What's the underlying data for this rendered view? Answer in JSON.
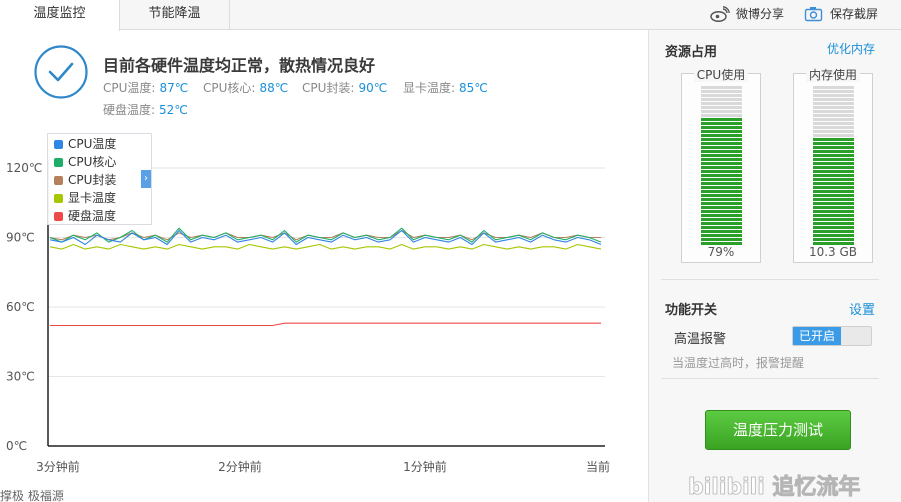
{
  "tabs": [
    {
      "label": "温度监控",
      "active": true
    },
    {
      "label": "节能降温",
      "active": false
    }
  ],
  "top_actions": {
    "share_label": "微博分享",
    "screenshot_label": "保存截屏"
  },
  "summary": {
    "title": "目前各硬件温度均正常，散热情况良好",
    "readings": [
      {
        "label": "CPU温度:",
        "value": "87℃"
      },
      {
        "label": "CPU核心:",
        "value": "88℃"
      },
      {
        "label": "CPU封装:",
        "value": "90℃"
      },
      {
        "label": "显卡温度:",
        "value": "85℃"
      },
      {
        "label": "硬盘温度:",
        "value": "52℃"
      }
    ]
  },
  "chart_data": {
    "type": "line",
    "ylim": [
      0,
      120
    ],
    "y_ticks": [
      "120℃",
      "90℃",
      "60℃",
      "30℃",
      "0℃"
    ],
    "x_ticks": [
      "3分钟前",
      "2分钟前",
      "1分钟前",
      "当前"
    ],
    "grid": true,
    "legend_position": "top-left",
    "series": [
      {
        "name": "CPU温度",
        "color": "#2f86e5",
        "values": [
          89,
          88,
          90,
          87,
          91,
          89,
          88,
          92,
          89,
          90,
          87,
          93,
          88,
          90,
          89,
          91,
          88,
          89,
          90,
          88,
          92,
          87,
          90,
          89,
          88,
          91,
          89,
          90,
          88,
          89,
          93,
          88,
          90,
          89,
          88,
          90,
          87,
          92,
          88,
          89,
          90,
          88,
          91,
          89,
          88,
          90,
          89,
          87
        ]
      },
      {
        "name": "CPU核心",
        "color": "#1fae6a",
        "values": [
          90,
          88,
          91,
          89,
          92,
          88,
          90,
          93,
          89,
          91,
          88,
          94,
          89,
          91,
          90,
          92,
          89,
          90,
          91,
          89,
          93,
          88,
          91,
          90,
          89,
          92,
          90,
          91,
          89,
          90,
          94,
          89,
          91,
          90,
          89,
          91,
          88,
          93,
          89,
          90,
          91,
          89,
          92,
          90,
          89,
          91,
          90,
          88
        ]
      },
      {
        "name": "CPU封装",
        "color": "#b5805a",
        "values": [
          90,
          89,
          91,
          90,
          91,
          89,
          90,
          92,
          90,
          91,
          89,
          92,
          90,
          91,
          90,
          92,
          90,
          90,
          91,
          90,
          92,
          89,
          91,
          90,
          90,
          92,
          90,
          91,
          90,
          90,
          93,
          90,
          91,
          90,
          90,
          91,
          89,
          92,
          90,
          90,
          91,
          90,
          92,
          90,
          90,
          91,
          90,
          90
        ]
      },
      {
        "name": "显卡温度",
        "color": "#a6c600",
        "values": [
          86,
          85,
          87,
          85,
          86,
          85,
          87,
          86,
          85,
          86,
          85,
          87,
          86,
          85,
          86,
          86,
          85,
          87,
          86,
          85,
          86,
          85,
          86,
          87,
          85,
          86,
          85,
          86,
          86,
          85,
          87,
          85,
          86,
          86,
          85,
          86,
          85,
          87,
          86,
          85,
          86,
          85,
          86,
          86,
          85,
          87,
          86,
          85
        ]
      },
      {
        "name": "硬盘温度",
        "color": "#ef4a4a",
        "values": [
          52,
          52,
          52,
          52,
          52,
          52,
          52,
          52,
          52,
          52,
          52,
          52,
          52,
          52,
          52,
          52,
          52,
          52,
          52,
          52,
          53,
          53,
          53,
          53,
          53,
          53,
          53,
          53,
          53,
          53,
          53,
          53,
          53,
          53,
          53,
          53,
          53,
          53,
          53,
          53,
          53,
          53,
          53,
          53,
          53,
          53,
          53,
          53
        ]
      }
    ]
  },
  "resources": {
    "title": "资源占用",
    "optimize_label": "优化内存",
    "cpu": {
      "label": "CPU使用",
      "value": "79%",
      "fraction": 0.79
    },
    "memory": {
      "label": "内存使用",
      "value": "10.3 GB",
      "fraction": 0.68
    }
  },
  "functions": {
    "title": "功能开关",
    "settings_label": "设置",
    "alert_label": "高温报警",
    "toggle_label": "已开启",
    "alert_desc": "当温度过高时，报警提醒",
    "stress_button": "温度压力测试"
  },
  "footer": {
    "left_text": "撑极 极福源",
    "watermark_text": "bilibili 追忆流年"
  },
  "colors": {
    "accent": "#1a8fd8",
    "meter_green": "#2aa02a",
    "button_green": "#4cb832"
  }
}
